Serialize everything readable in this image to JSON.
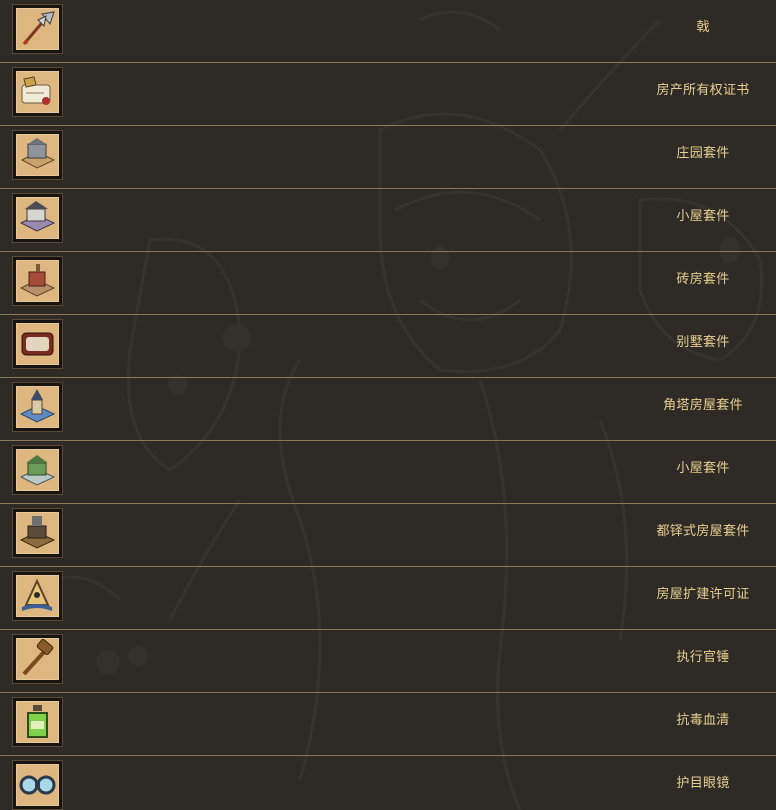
{
  "items": [
    {
      "label": "戟",
      "icon": "halberd-icon"
    },
    {
      "label": "房产所有权证书",
      "icon": "deed-scroll-icon"
    },
    {
      "label": "庄园套件",
      "icon": "manor-kit-icon"
    },
    {
      "label": "小屋套件",
      "icon": "cottage-kit-icon"
    },
    {
      "label": "砖房套件",
      "icon": "brick-house-kit-icon"
    },
    {
      "label": "别墅套件",
      "icon": "villa-kit-icon"
    },
    {
      "label": "角塔房屋套件",
      "icon": "turret-house-kit-icon"
    },
    {
      "label": "小屋套件",
      "icon": "cabin-kit-icon"
    },
    {
      "label": "都铎式房屋套件",
      "icon": "tudor-house-kit-icon"
    },
    {
      "label": "房屋扩建许可证",
      "icon": "expansion-permit-icon"
    },
    {
      "label": "执行官锤",
      "icon": "gavel-icon"
    },
    {
      "label": "抗毒血清",
      "icon": "antivenom-bottle-icon"
    },
    {
      "label": "护目眼镜",
      "icon": "goggles-icon"
    }
  ],
  "colors": {
    "background": "#2e2b27",
    "divider": "#8b7a55",
    "label_text": "#e8cf8f",
    "icon_bg": "#ddb680"
  }
}
